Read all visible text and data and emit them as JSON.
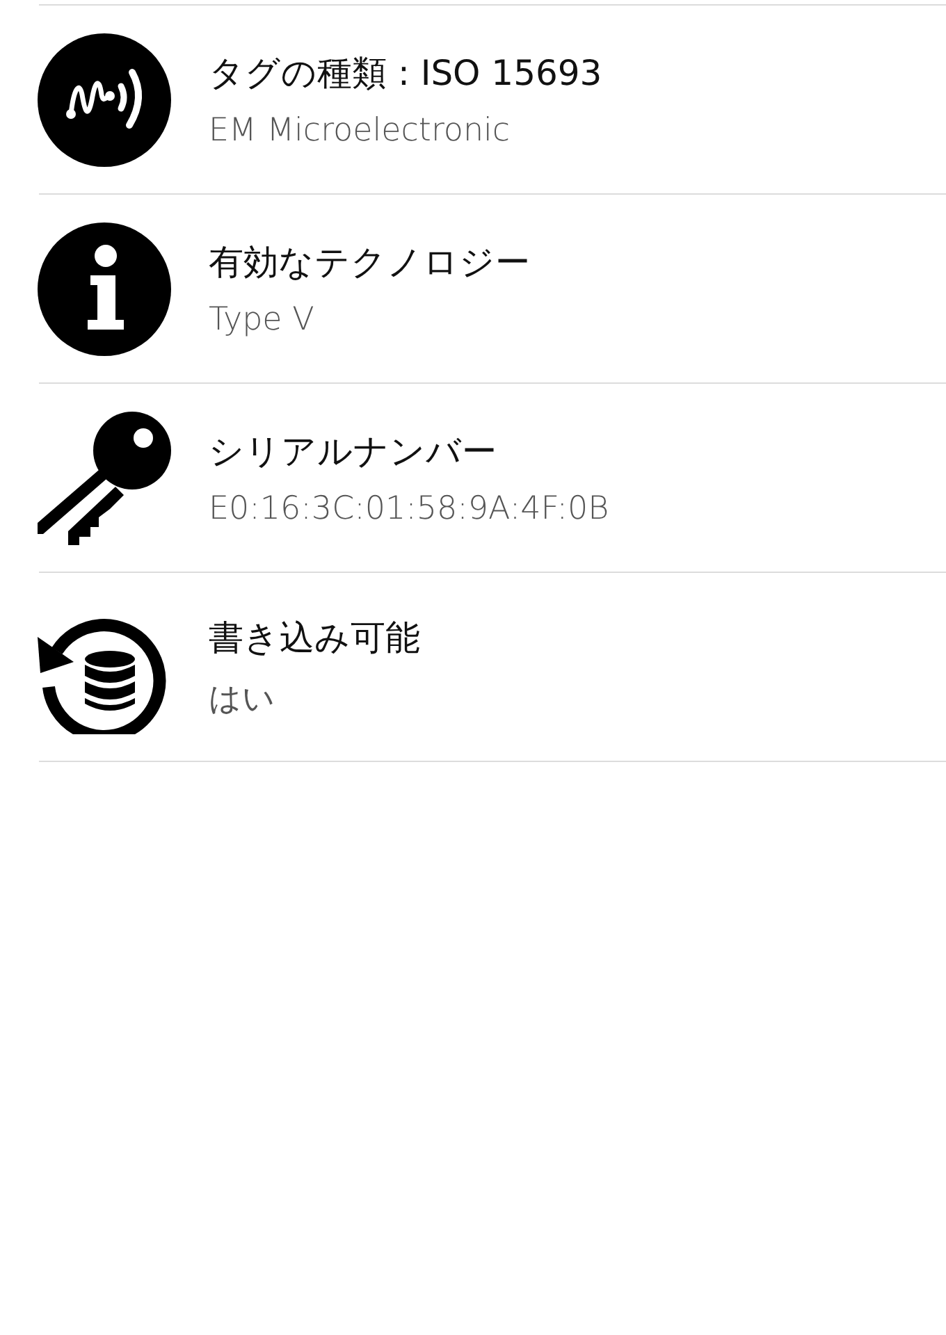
{
  "items": [
    {
      "kind": "tag",
      "title": "タグの種類 : ISO 15693",
      "subtitle": "EM Microelectronic"
    },
    {
      "kind": "info",
      "title": "有効なテクノロジー",
      "subtitle": "Type V"
    },
    {
      "kind": "key",
      "title": "シリアルナンバー",
      "subtitle": "E0:16:3C:01:58:9A:4F:0B"
    },
    {
      "kind": "storage",
      "title": "書き込み可能",
      "subtitle": "はい"
    }
  ]
}
